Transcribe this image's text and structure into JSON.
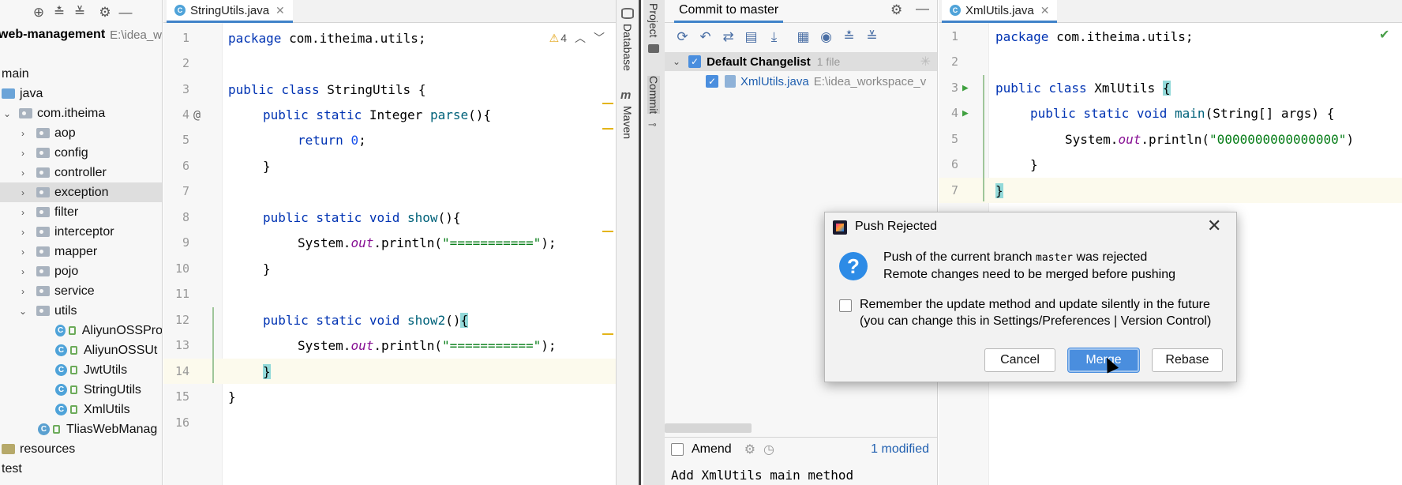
{
  "project": {
    "title": "web-management",
    "path": "E:\\idea_w",
    "items": [
      {
        "label": "main",
        "level": 0
      },
      {
        "label": "java",
        "level": 0
      },
      {
        "label": "com.itheima",
        "level": 1
      },
      {
        "label": "aop",
        "level": 2
      },
      {
        "label": "config",
        "level": 2
      },
      {
        "label": "controller",
        "level": 2
      },
      {
        "label": "exception",
        "level": 2
      },
      {
        "label": "filter",
        "level": 2
      },
      {
        "label": "interceptor",
        "level": 2
      },
      {
        "label": "mapper",
        "level": 2
      },
      {
        "label": "pojo",
        "level": 2
      },
      {
        "label": "service",
        "level": 2
      },
      {
        "label": "utils",
        "level": 2
      },
      {
        "label": "AliyunOSSPro",
        "level": 3
      },
      {
        "label": "AliyunOSSUt",
        "level": 3
      },
      {
        "label": "JwtUtils",
        "level": 3
      },
      {
        "label": "StringUtils",
        "level": 3
      },
      {
        "label": "XmlUtils",
        "level": 3
      },
      {
        "label": "TliasWebManag",
        "level": 2
      },
      {
        "label": "resources",
        "level": 0
      },
      {
        "label": "test",
        "level": 0
      }
    ]
  },
  "editor1": {
    "tab_label": "StringUtils.java",
    "warnings": "4",
    "lines": [
      {
        "n": "1",
        "code": "package com.itheima.utils;"
      },
      {
        "n": "2",
        "code": ""
      },
      {
        "n": "3",
        "code": "public class StringUtils {"
      },
      {
        "n": "4",
        "code": "    public static Integer parse(){"
      },
      {
        "n": "5",
        "code": "        return 0;"
      },
      {
        "n": "6",
        "code": "    }"
      },
      {
        "n": "7",
        "code": ""
      },
      {
        "n": "8",
        "code": "    public static void show(){"
      },
      {
        "n": "9",
        "code": "        System.out.println(\"===========\");"
      },
      {
        "n": "10",
        "code": "    }"
      },
      {
        "n": "11",
        "code": ""
      },
      {
        "n": "12",
        "code": "    public static void show2(){"
      },
      {
        "n": "13",
        "code": "        System.out.println(\"===========\");"
      },
      {
        "n": "14",
        "code": "    }"
      },
      {
        "n": "15",
        "code": "}"
      },
      {
        "n": "16",
        "code": ""
      }
    ]
  },
  "side_strip": {
    "database": "Database",
    "maven": "Maven",
    "project": "Project",
    "commit": "Commit"
  },
  "commit_panel": {
    "title": "Commit to master",
    "changelist": "Default Changelist",
    "changelist_count": "1 file",
    "file_name": "XmlUtils.java",
    "file_path": "E:\\idea_workspace_v",
    "amend_label": "Amend",
    "modified_label": "1 modified",
    "message": "Add XmlUtils main method"
  },
  "editor2": {
    "tab_label": "XmlUtils.java",
    "lines": [
      {
        "n": "1",
        "code": "package com.itheima.utils;"
      },
      {
        "n": "2",
        "code": ""
      },
      {
        "n": "3",
        "code": "public class XmlUtils {"
      },
      {
        "n": "4",
        "code": "    public static void main(String[] args) {"
      },
      {
        "n": "5",
        "code": "        System.out.println(\"0000000000000000\")"
      },
      {
        "n": "6",
        "code": "    }"
      },
      {
        "n": "7",
        "code": "}"
      }
    ]
  },
  "dialog": {
    "title": "Push Rejected",
    "message_pre": "Push of the current branch",
    "branch": "master",
    "message_post": "was rejected",
    "message_line2": "Remote changes need to be merged before pushing",
    "remember_line1": "Remember the update method and update silently in the future",
    "remember_line2": "(you can change this in Settings/Preferences | Version Control)",
    "cancel": "Cancel",
    "merge": "Merge",
    "rebase": "Rebase"
  }
}
